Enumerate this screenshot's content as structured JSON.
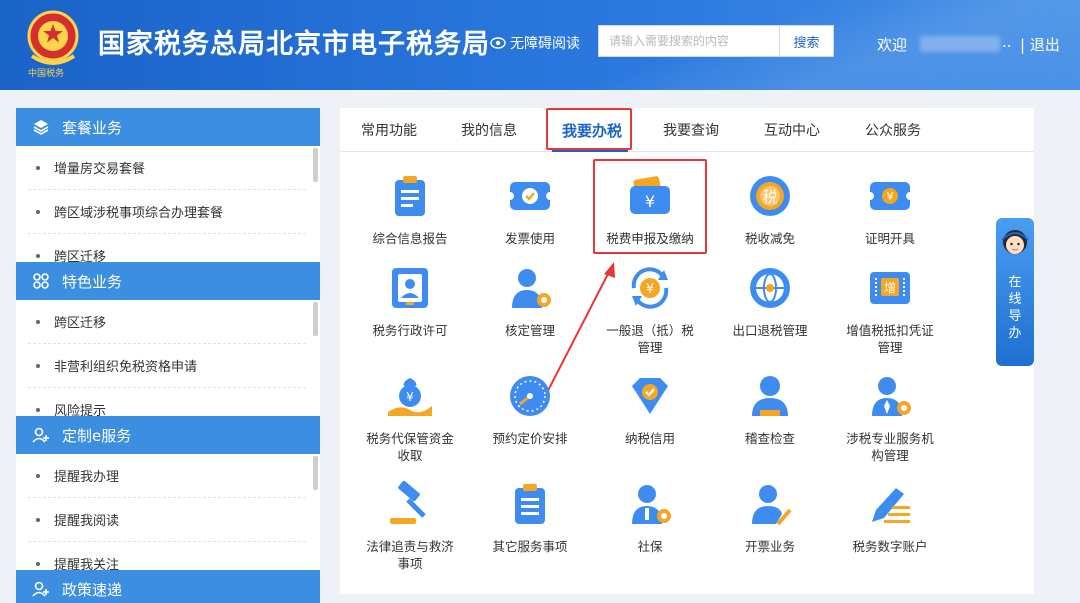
{
  "header": {
    "emblem_text": "中国税务",
    "title": "国家税务总局北京市电子税务局",
    "accessibility": "无障碍阅读",
    "search_placeholder": "请输入需要搜索的内容",
    "search_button": "搜索",
    "welcome": "欢迎",
    "user_dots": "..",
    "logout": "| 退出"
  },
  "sidebar": {
    "sections": [
      {
        "title": "套餐业务",
        "items": [
          "增量房交易套餐",
          "跨区域涉税事项综合办理套餐",
          "跨区迁移"
        ]
      },
      {
        "title": "特色业务",
        "items": [
          "跨区迁移",
          "非营利组织免税资格申请",
          "风险提示"
        ]
      },
      {
        "title": "定制e服务",
        "items": [
          "提醒我办理",
          "提醒我阅读",
          "提醒我关注"
        ]
      },
      {
        "title": "政策速递",
        "items": []
      }
    ]
  },
  "tabs": [
    "常用功能",
    "我的信息",
    "我要办税",
    "我要查询",
    "互动中心",
    "公众服务"
  ],
  "grid": [
    [
      "综合信息报告",
      "发票使用",
      "税费申报及缴纳",
      "税收减免",
      "证明开具"
    ],
    [
      "税务行政许可",
      "核定管理",
      "一般退（抵）税管理",
      "出口退税管理",
      "增值税抵扣凭证管理"
    ],
    [
      "税务代保管资金收取",
      "预约定价安排",
      "纳税信用",
      "稽查检查",
      "涉税专业服务机构管理"
    ],
    [
      "法律追责与救济事项",
      "其它服务事项",
      "社保",
      "开票业务",
      "税务数字账户"
    ]
  ],
  "grid_lines": [
    [
      "综合信息报告",
      "发票使用",
      "税费申报及缴纳",
      "税收减免",
      "证明开具"
    ],
    [
      "税务行政许可",
      "核定管理",
      "一般退（抵）税",
      "出口退税管理",
      "增值税抵扣凭证"
    ],
    [
      "",
      "",
      "管理",
      "",
      "管理"
    ],
    [
      "税务代保管资金",
      "预约定价安排",
      "纳税信用",
      "稽查检查",
      "涉税专业服务机"
    ],
    [
      "收取",
      "",
      "",
      "",
      "构管理"
    ],
    [
      "法律追责与救济",
      "其它服务事项",
      "社保",
      "开票业务",
      "税务数字账户"
    ],
    [
      "事项",
      "",
      "",
      "",
      ""
    ]
  ],
  "guide": {
    "text": [
      "在",
      "线",
      "导",
      "办"
    ]
  },
  "icon_names": [
    "report-icon",
    "invoice-icon",
    "tax-declare-icon",
    "tax-relief-icon",
    "certificate-icon",
    "license-icon",
    "verify-manage-icon",
    "refund-icon",
    "export-refund-icon",
    "vat-voucher-icon",
    "custody-fund-icon",
    "pricing-icon",
    "credit-icon",
    "inspection-icon",
    "service-agency-icon",
    "legal-icon",
    "other-service-icon",
    "social-security-icon",
    "billing-icon",
    "digital-account-icon"
  ],
  "colors": {
    "primary": "#1e64c8",
    "header": "#2a78de",
    "sidebar_head": "#3c8ee0",
    "highlight": "#e53935",
    "accent_orange": "#f5a623"
  }
}
